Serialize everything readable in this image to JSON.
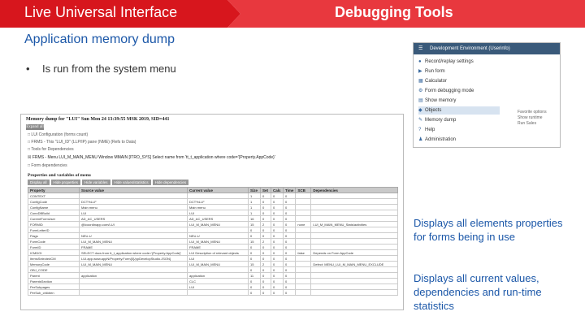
{
  "header": {
    "left_title": "Live Universal Interface",
    "right_title": "Debugging Tools",
    "colors": {
      "banner_dark": "#d7161d",
      "banner_light": "#e8383e",
      "text_blue": "#1b57a8"
    }
  },
  "slide": {
    "subtitle": "Application memory dump",
    "bullet_glyph": "•",
    "bullet_text": "Is run from the system menu",
    "description_1": "Displays all elements properties for forms being in use",
    "description_2": "Displays all current values, dependencies and run-time statistics"
  },
  "dump": {
    "title": "Memory dump for \"LUI\" Sun Mon 24 13:39:55 MSK 2019, SID=441",
    "button": "Expand all",
    "rows": [
      "□ LUI Configuration (forms count)",
      "□ FRMS - This \"LUI_ID\" (LLP/IP) pane (NME) (Refs to Data)",
      "□ Tools for Dependencies",
      "☒ FRMS - Menu LUI_M_MAIN_MENU Window MMAIN [ITRO_SYS] Select name from 'tt_t_application where code='{Property.AppCode}'",
      "□ Form dependencies"
    ],
    "section": "Properties and variables of menu",
    "tabs": [
      "Display all",
      "Hide properties",
      "Hide variables",
      "Hide values/statistics",
      "Hide dependencies"
    ],
    "headers": [
      "Property",
      "Source value",
      "Current value",
      "Size",
      "Set",
      "Calc",
      "Time",
      "SCB",
      "Dependencies"
    ],
    "table_rows": [
      [
        "CONTEXT",
        "",
        "",
        "1",
        "0",
        "0",
        "0",
        "",
        ""
      ],
      [
        "ConfigCode",
        "DCT%LLF",
        "DCT%LLF",
        "1",
        "0",
        "0",
        "0",
        "",
        ""
      ],
      [
        "ConfigName",
        "Main menu",
        "Main menu",
        "1",
        "0",
        "0",
        "0",
        "",
        ""
      ],
      [
        "ConnDBBuild",
        "LUI",
        "LUI",
        "1",
        "0",
        "0",
        "0",
        "",
        ""
      ],
      [
        "CurrentFormUser",
        "AD_AC_USERS",
        "AD_AC_USERS",
        "16",
        "0",
        "0",
        "0",
        "",
        ""
      ],
      [
        "FORMID",
        "@lcoordinapp.com/LUI",
        "LUI_M_MAIN_MENU",
        "15",
        "2",
        "0",
        "0",
        "none",
        "LUI_M_MAIN_MENU_Stats/activities"
      ],
      [
        "FormLetterID",
        "",
        "",
        "0",
        "0",
        "0",
        "0",
        "",
        ""
      ],
      [
        "Flags",
        "NEU-U",
        "NEU-U",
        "0",
        "0",
        "0",
        "0",
        "",
        ""
      ],
      [
        "FormCode",
        "LUI_M_MAIN_MENU",
        "LUI_M_MAIN_MENU",
        "15",
        "2",
        "0",
        "0",
        "",
        ""
      ],
      [
        "FormID",
        "FRAME",
        "FRAME",
        "0",
        "0",
        "0",
        "0",
        "",
        ""
      ],
      [
        "ICMDOI",
        "SELECT docs from tt_t_application where code='{Property.AppCode}'",
        "LUI Description of relevant objects",
        "0",
        "0",
        "0",
        "0",
        "false",
        "Depends on Form AppCode"
      ],
      [
        "ItemsSelectedCM",
        "LUI.app.www.appN/Property.Form{0}/ppDevelopStudio.JSON}",
        "LUI",
        "0",
        "0",
        "0",
        "0",
        "",
        ""
      ],
      [
        "MemoryCode",
        "LUI_M_MAIN_MENU",
        "LUI_M_MAIN_MENU",
        "15",
        "2",
        "0",
        "0",
        "",
        "Defect: MENU_LUI_M_MAIN_MENU_EXCLUDE"
      ],
      [
        "OBJ_CODE",
        "",
        "",
        "0",
        "0",
        "0",
        "0",
        "",
        ""
      ],
      [
        "Parent",
        "application",
        "application",
        "11",
        "0",
        "0",
        "0",
        "",
        ""
      ],
      [
        "ParentsSection",
        "",
        "CLC",
        "0",
        "0",
        "0",
        "0",
        "",
        ""
      ],
      [
        "PerSubpages",
        "",
        "LUI",
        "0",
        "0",
        "0",
        "0",
        "",
        ""
      ],
      [
        "PerSub_children",
        "",
        "",
        "0",
        "0",
        "0",
        "0",
        "",
        ""
      ]
    ]
  },
  "menu": {
    "title": "Development Environment (Userinfo)",
    "items": [
      {
        "icon": "record-icon",
        "glyph": "●",
        "label": "Record/replay settings"
      },
      {
        "icon": "run-icon",
        "glyph": "▶",
        "label": "Run form"
      },
      {
        "icon": "calculator-icon",
        "glyph": "▦",
        "label": "Calculator"
      },
      {
        "icon": "settings-icon",
        "glyph": "⚙",
        "label": "Form debugging mode"
      },
      {
        "icon": "memory-icon",
        "glyph": "▤",
        "label": "Show memory"
      },
      {
        "icon": "objects-icon",
        "glyph": "◆",
        "label": "Objects"
      },
      {
        "icon": "dump-icon",
        "glyph": "✎",
        "label": "Memory dump"
      },
      {
        "icon": "help-icon",
        "glyph": "?",
        "label": "Help"
      },
      {
        "icon": "admin-icon",
        "glyph": "♟",
        "label": "Administration"
      }
    ],
    "side_notes": [
      "Favorite options",
      "Show runtime",
      "Run Sales"
    ]
  }
}
